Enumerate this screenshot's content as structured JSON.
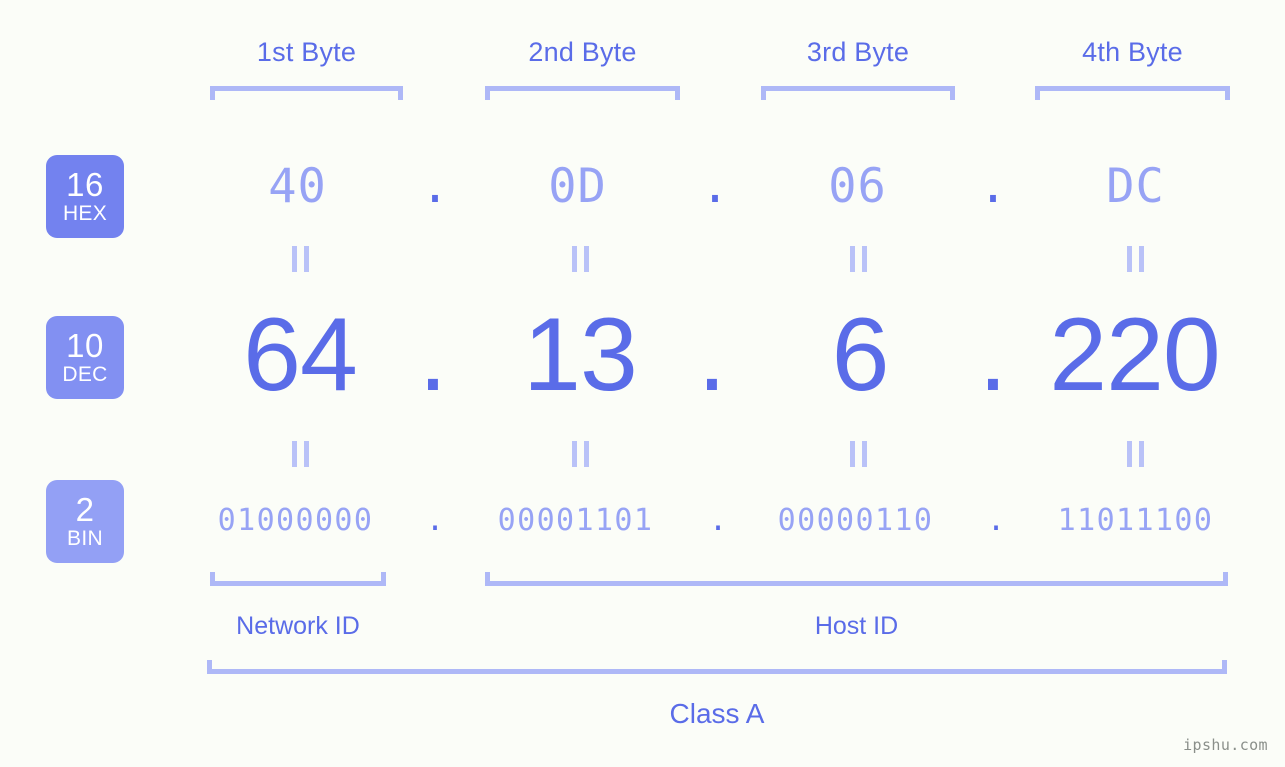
{
  "background_color": "#fbfdf8",
  "accent_color": "#5a6ce8",
  "muted_color": "#97a3f5",
  "bracket_color": "#aeb8f7",
  "byte_headers": [
    {
      "label": "1st Byte"
    },
    {
      "label": "2nd Byte"
    },
    {
      "label": "3rd Byte"
    },
    {
      "label": "4th Byte"
    }
  ],
  "systems": [
    {
      "base": "16",
      "name": "HEX",
      "color": "#7382ef"
    },
    {
      "base": "10",
      "name": "DEC",
      "color": "#8290f2"
    },
    {
      "base": "2",
      "name": "BIN",
      "color": "#93a0f5"
    }
  ],
  "separator": ".",
  "rows": {
    "hex": {
      "values": [
        "40",
        "0D",
        "06",
        "DC"
      ]
    },
    "dec": {
      "values": [
        "64",
        "13",
        "6",
        "220"
      ]
    },
    "bin": {
      "values": [
        "01000000",
        "00001101",
        "00000110",
        "11011100"
      ]
    }
  },
  "equivalence_symbol": "=",
  "segments": {
    "network_id": "Network ID",
    "host_id": "Host ID"
  },
  "class_label": "Class A",
  "watermark": "ipshu.com"
}
